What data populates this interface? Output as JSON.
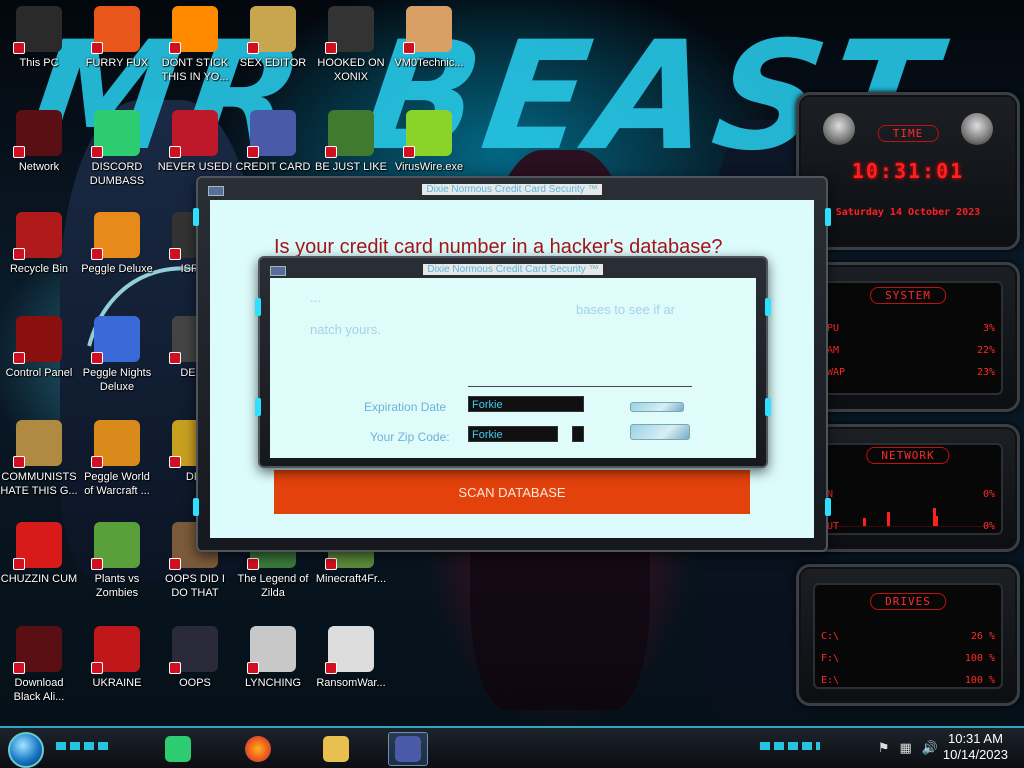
{
  "desktop_icons": [
    {
      "label": "This PC",
      "icon": "computer-icon",
      "color": "#2a2a2a"
    },
    {
      "label": "FURRY FUX",
      "icon": "firefox-icon",
      "color": "#e8561b"
    },
    {
      "label": "DONT STICK THIS IN YO...",
      "icon": "traffic-cone-icon",
      "color": "#ff8a00"
    },
    {
      "label": "SEX EDITOR",
      "icon": "hxd-editor-icon",
      "color": "#c8a650"
    },
    {
      "label": "HOOKED ON XONIX",
      "icon": "xonix-game-icon",
      "color": "#333333"
    },
    {
      "label": "VM0Technic...",
      "icon": "doctor-icon",
      "color": "#d9a066"
    },
    {
      "label": "Network",
      "icon": "alienware-icon",
      "color": "#5a0f14"
    },
    {
      "label": "DISCORD DUMBASS",
      "icon": "chat-app-icon",
      "color": "#2ecc71"
    },
    {
      "label": "NEVER USED!",
      "icon": "dev-icon",
      "color": "#c0182b"
    },
    {
      "label": "CREDIT CARD",
      "icon": "credit-card-icon",
      "color": "#4a5aa8"
    },
    {
      "label": "BE JUST LIKE",
      "icon": "santa-icon",
      "color": "#3f7a30"
    },
    {
      "label": "VirusWire.exe",
      "icon": "lime-icon",
      "color": "#8bd329"
    },
    {
      "label": "Recycle Bin",
      "icon": "recycle-bin-icon",
      "color": "#b01a1a"
    },
    {
      "label": "Peggle Deluxe",
      "icon": "peggle-icon",
      "color": "#e88a1a"
    },
    {
      "label": "ISRAI",
      "icon": "game-icon",
      "color": "#333333"
    },
    {
      "label": "Control Panel",
      "icon": "control-panel-icon",
      "color": "#8a1010"
    },
    {
      "label": "Peggle Nights Deluxe",
      "icon": "peggle-nights-icon",
      "color": "#3a6ad8"
    },
    {
      "label": "DEEZ",
      "icon": "app-icon",
      "color": "#444444"
    },
    {
      "label": "COMMUNISTS HATE THIS G...",
      "icon": "money-bag-icon",
      "color": "#b08a40"
    },
    {
      "label": "Peggle World of Warcraft ...",
      "icon": "peggle-wow-icon",
      "color": "#d88a1a"
    },
    {
      "label": "DIE",
      "icon": "app-icon",
      "color": "#c8a020"
    },
    {
      "label": "CHUZZIN CUM",
      "icon": "chuzzle-icon",
      "color": "#d81a1a"
    },
    {
      "label": "Plants vs Zombies",
      "icon": "plants-vs-zombies-icon",
      "color": "#5aa03a"
    },
    {
      "label": "OOPS DID I DO THAT",
      "icon": "cat-icon",
      "color": "#7a5a3a"
    },
    {
      "label": "The Legend of Zilda",
      "icon": "zelda-icon",
      "color": "#3a7a3a"
    },
    {
      "label": "Minecraft4Fr...",
      "icon": "minecraft-icon",
      "color": "#5a8a3a"
    },
    {
      "label": "Download Black Ali...",
      "icon": "alienware-icon",
      "color": "#5a0f14"
    },
    {
      "label": "UKRAINE",
      "icon": "radiation-icon",
      "color": "#c0181a"
    },
    {
      "label": "OOPS",
      "icon": "monitor-icon",
      "color": "#2a2a3a"
    },
    {
      "label": "LYNCHING",
      "icon": "rope-icon",
      "color": "#c8c8c8"
    },
    {
      "label": "RansomWar...",
      "icon": "skull-icon",
      "color": "#dddddd"
    }
  ],
  "wallpaper": {
    "text": "MR BEAST",
    "accent": "#27c7e6"
  },
  "gadgets": {
    "time": {
      "title": "TIME",
      "time": "10:31:01",
      "date": "Saturday 14 October 2023"
    },
    "system": {
      "title": "SYSTEM",
      "rows": [
        {
          "label": "CPU",
          "value": "3%"
        },
        {
          "label": "RAM",
          "value": "22%"
        },
        {
          "label": "SWAP",
          "value": "23%"
        }
      ]
    },
    "network": {
      "title": "NETWORK",
      "rows": [
        {
          "label": "IN",
          "value": "0%"
        },
        {
          "label": "OUT",
          "value": "0%"
        }
      ]
    },
    "drives": {
      "title": "DRIVES",
      "rows": [
        {
          "label": "C:\\",
          "value": "26 %"
        },
        {
          "label": "F:\\",
          "value": "100 %"
        },
        {
          "label": "E:\\",
          "value": "100 %"
        }
      ]
    }
  },
  "back_window": {
    "title": "Dixie Normous Credit Card Security ™",
    "heading": "Is your credit card number in a hacker's database?",
    "scan_label": "SCAN DATABASE"
  },
  "front_window": {
    "title": "Dixie Normous Credit Card Security ™",
    "faded_line1_left": "...",
    "faded_line1_right": "bases to see if ar",
    "faded_line2": "natch yours.",
    "expiration_label": "Expiration Date",
    "expiration_value": "Forkie",
    "zip_label": "Your Zip Code:",
    "zip_value": "Forkie"
  },
  "taskbar": {
    "apps": [
      {
        "name": "chat-app",
        "icon": "chat-app-icon",
        "color": "#2ecc71"
      },
      {
        "name": "firefox",
        "icon": "firefox-icon",
        "color": "#e8561b"
      },
      {
        "name": "file-explorer",
        "icon": "folder-icon",
        "color": "#e8c050"
      },
      {
        "name": "credit-card-app",
        "icon": "credit-card-icon",
        "color": "#4a5aa8"
      }
    ],
    "time": "10:31 AM",
    "date": "10/14/2023"
  }
}
